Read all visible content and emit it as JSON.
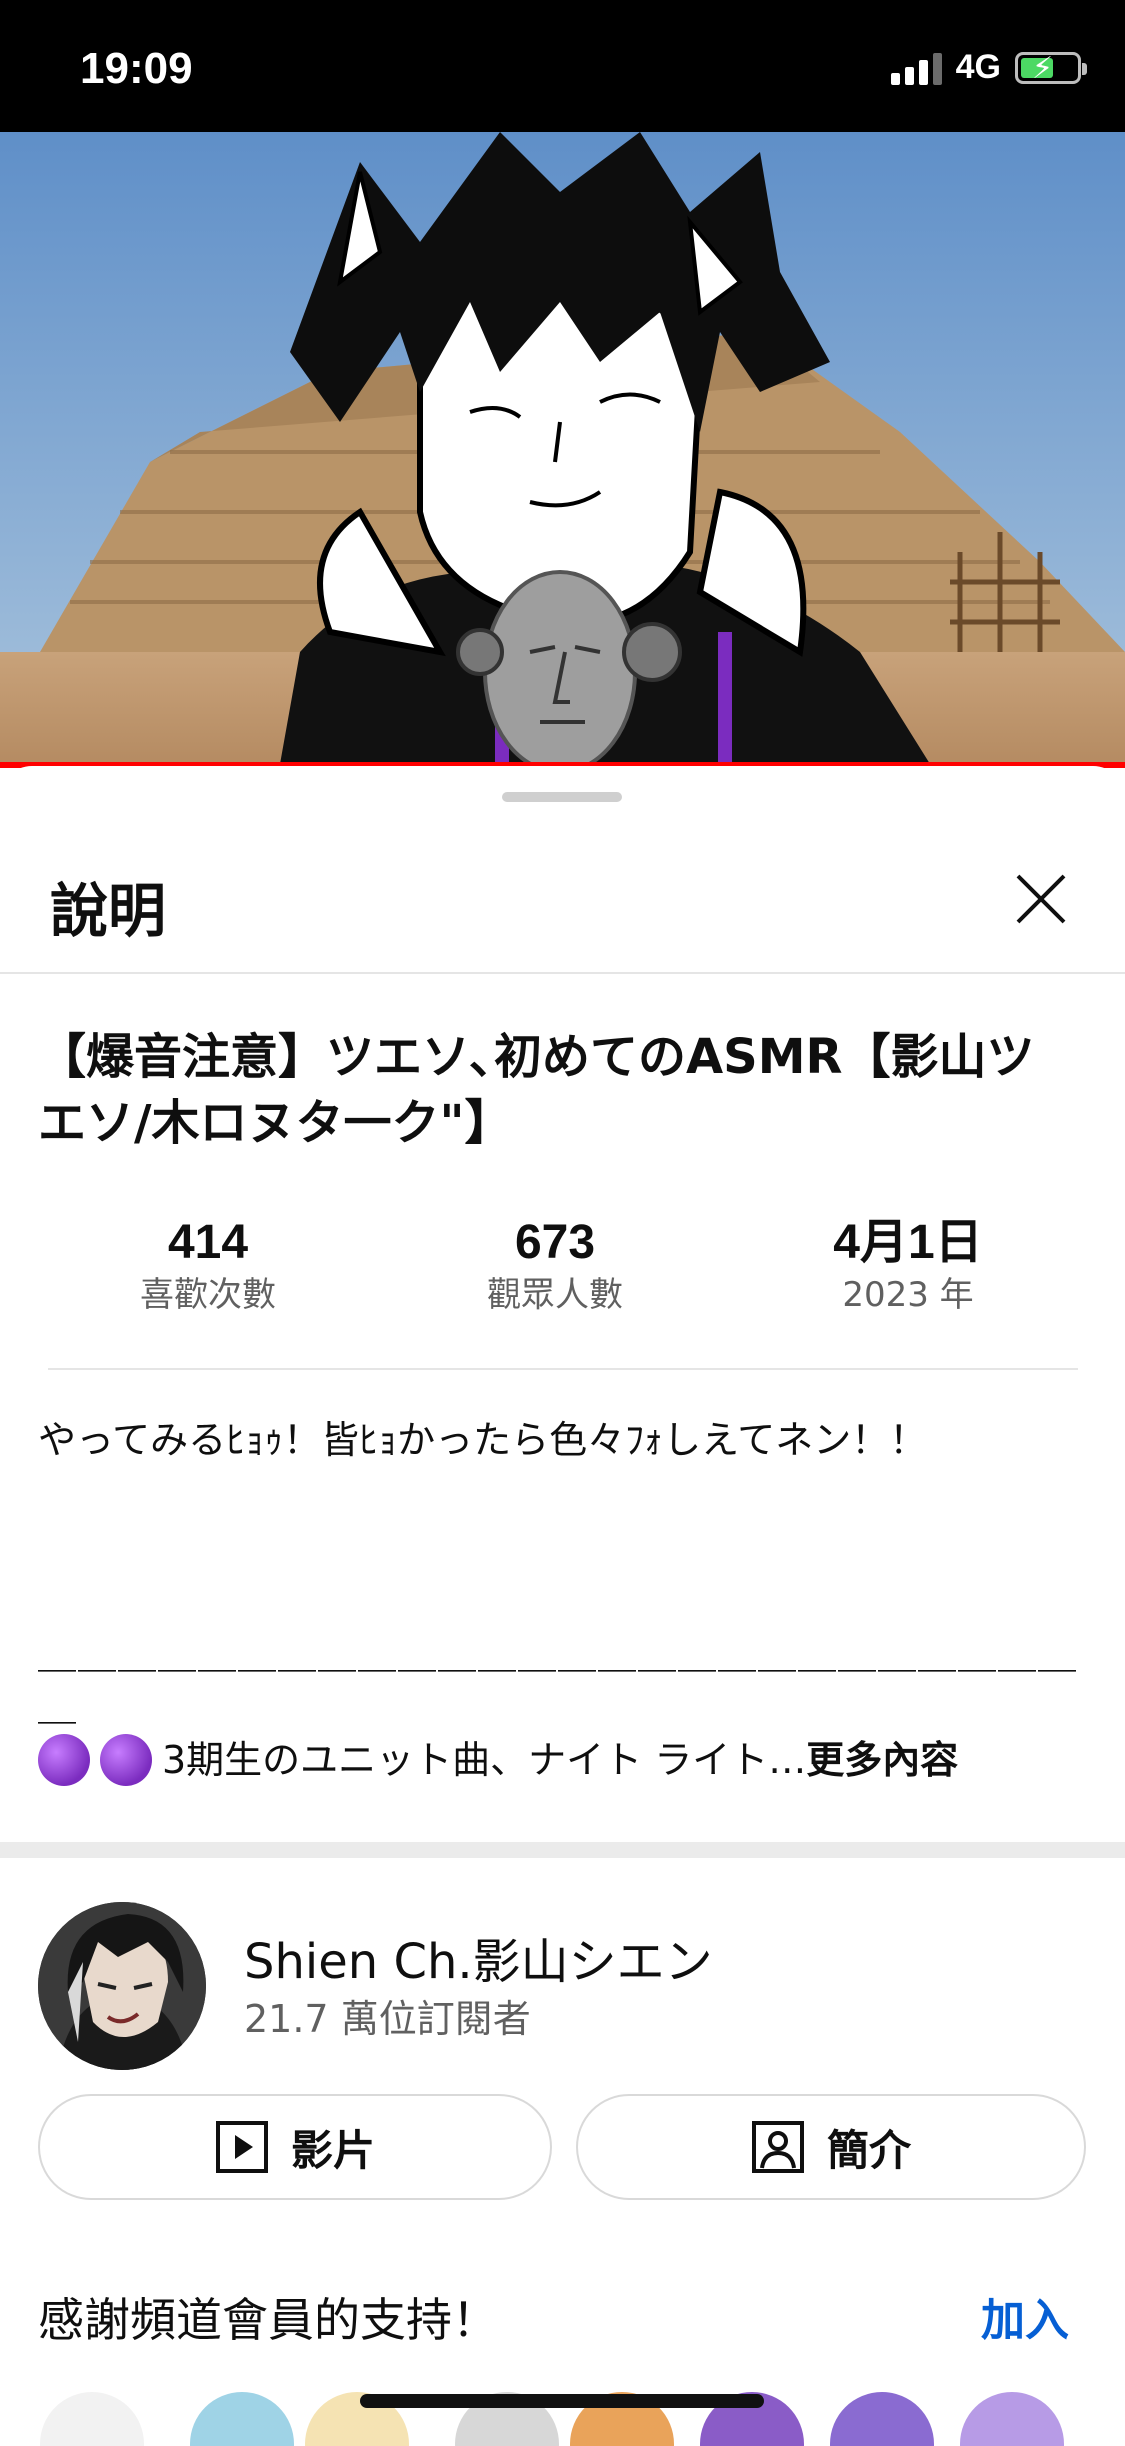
{
  "status_bar": {
    "time": "19:09",
    "network": "4G",
    "battery_level": 0.6,
    "accent": "#4cd964"
  },
  "video": {
    "progress_color": "#ff0000"
  },
  "sheet": {
    "title": "說明",
    "video_title": "【爆音注意】ツエソ､初めてのASMR【影山ツエソ/木ロヌタ一ク\"】",
    "stats": [
      {
        "value": "414",
        "label": "喜歡次數"
      },
      {
        "value": "673",
        "label": "觀眾人數"
      },
      {
        "value": "4月1日",
        "label": "2023 年"
      }
    ],
    "description_line1": "やってみるﾋｮｩ！皆ﾋｮかったら色々ﾌｫしえてネン！！",
    "description_dashes": "＿＿＿＿＿＿＿＿＿＿＿＿＿＿＿＿＿＿＿＿＿＿＿＿＿＿＿",
    "description_last": "3期生のユニット曲、ナイト ライト…",
    "more_label": "更多內容"
  },
  "channel": {
    "name": "Shien Ch.影山シエン",
    "subscribers": "21.7 萬位訂閱者",
    "videos_button": "影片",
    "about_button": "簡介"
  },
  "membership": {
    "text": "感謝頻道會員的支持！",
    "join_label": "加入",
    "join_color": "#065fd4"
  }
}
